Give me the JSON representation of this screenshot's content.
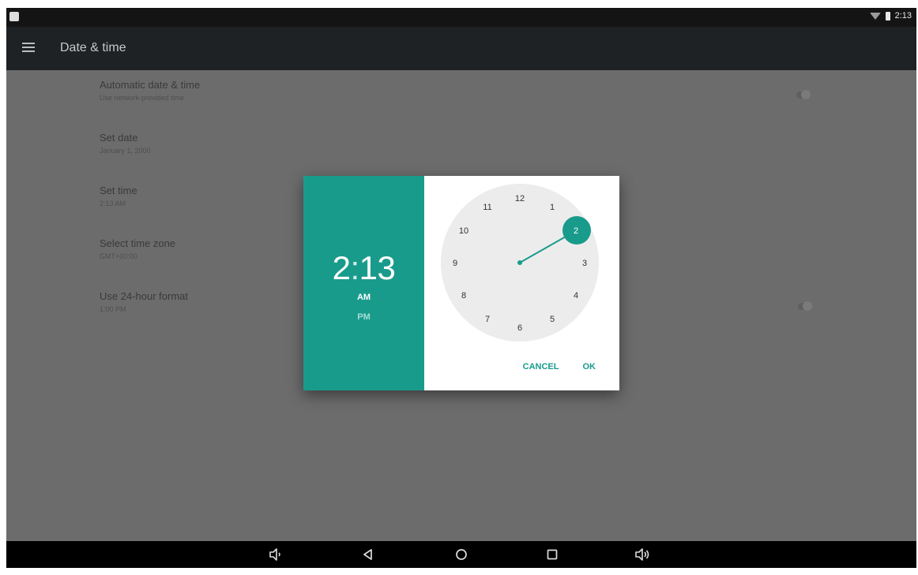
{
  "status_bar": {
    "time": "2:13"
  },
  "app_bar": {
    "title": "Date & time",
    "menu_icon": "menu-icon"
  },
  "settings": [
    {
      "title": "Automatic date & time",
      "summary": "Use network-provided time",
      "control": "toggle"
    },
    {
      "title": "Set date",
      "summary": "January 1, 2000",
      "control": "none"
    },
    {
      "title": "Set time",
      "summary": "2:13 AM",
      "control": "none"
    },
    {
      "title": "Select time zone",
      "summary": "GMT+00:00",
      "control": "none"
    },
    {
      "title": "Use 24-hour format",
      "summary": "1:00 PM",
      "control": "toggle"
    }
  ],
  "time_picker": {
    "hour": "2",
    "separator": ":",
    "minute": "13",
    "am_label": "AM",
    "pm_label": "PM",
    "selected_period": "AM",
    "selected_hour": "2",
    "clock_numbers": [
      "12",
      "1",
      "2",
      "3",
      "4",
      "5",
      "6",
      "7",
      "8",
      "9",
      "10",
      "11"
    ],
    "cancel_label": "CANCEL",
    "ok_label": "OK",
    "accent_color": "#199b8c"
  },
  "nav_bar": {
    "icons": [
      "volume-down-icon",
      "back-icon",
      "home-icon",
      "recents-icon",
      "volume-up-icon"
    ]
  }
}
